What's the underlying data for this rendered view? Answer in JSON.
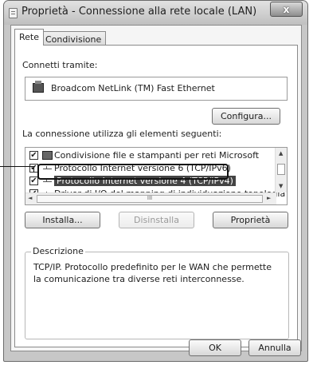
{
  "window": {
    "title": "Proprietà - Connessione alla rete locale (LAN)",
    "close_glyph": "x"
  },
  "tabs": [
    {
      "label": "Rete",
      "active": true
    },
    {
      "label": "Condivisione",
      "active": false
    }
  ],
  "connect_via": {
    "label": "Connetti tramite:",
    "adapter": "Broadcom NetLink (TM) Fast Ethernet",
    "configure_button": "Configura..."
  },
  "items_section": {
    "label": "La connessione utilizza gli elementi seguenti:",
    "items": [
      {
        "label": "Condivisione file e stampanti per reti Microsoft",
        "checked": true,
        "icon": "share-icon"
      },
      {
        "label": "Protocollo Internet versione 6 (TCP/IPv6)",
        "checked": true,
        "icon": "protocol-icon"
      },
      {
        "label": "Protocollo Internet versione 4 (TCP/IPv4)",
        "checked": true,
        "icon": "protocol-icon",
        "selected": true
      },
      {
        "label": "Driver di I/O del mapping di individuazione topologia liv",
        "checked": true,
        "icon": "protocol-icon"
      }
    ],
    "check_glyph": "✔"
  },
  "actions": {
    "install": "Installa...",
    "uninstall": "Disinstalla",
    "properties": "Proprietà"
  },
  "description": {
    "title": "Descrizione",
    "text": "TCP/IP. Protocollo predefinito per le WAN che permette la comunicazione tra diverse reti interconnesse."
  },
  "footer": {
    "ok": "OK",
    "cancel": "Annulla"
  },
  "scroll_glyphs": {
    "up": "▲",
    "down": "▼",
    "left": "◄",
    "right": "►",
    "grip": "III"
  }
}
